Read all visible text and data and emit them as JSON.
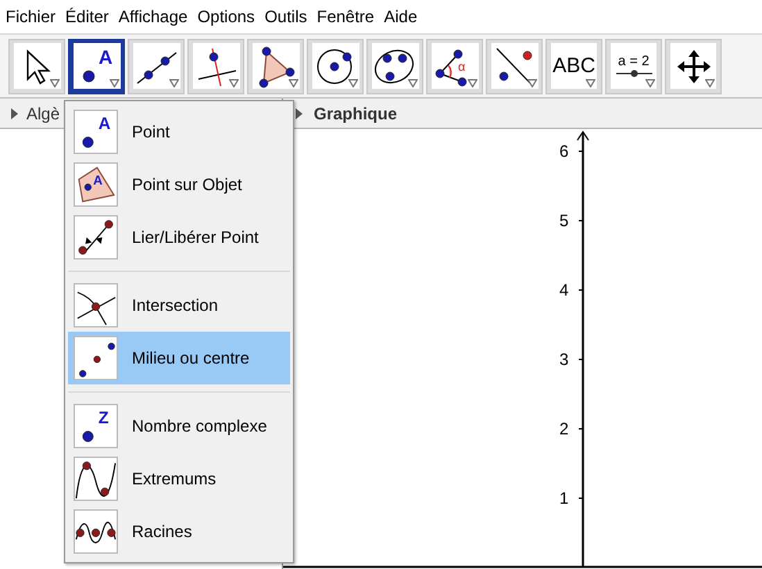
{
  "menubar": [
    "Fichier",
    "Éditer",
    "Affichage",
    "Options",
    "Outils",
    "Fenêtre",
    "Aide"
  ],
  "toolbar": [
    {
      "kind": "move",
      "selected": false
    },
    {
      "kind": "point",
      "letter": "A",
      "selected": true
    },
    {
      "kind": "line",
      "selected": false
    },
    {
      "kind": "perpendicular",
      "selected": false
    },
    {
      "kind": "polygon",
      "selected": false
    },
    {
      "kind": "circle",
      "selected": false
    },
    {
      "kind": "conic",
      "selected": false
    },
    {
      "kind": "angle",
      "letter": "α",
      "selected": false
    },
    {
      "kind": "reflect",
      "selected": false
    },
    {
      "kind": "text",
      "label": "ABC",
      "selected": false
    },
    {
      "kind": "slider",
      "label": "a = 2",
      "selected": false
    },
    {
      "kind": "move-view",
      "selected": false
    }
  ],
  "panels": [
    {
      "title": "Algè"
    },
    {
      "title": "Graphique"
    }
  ],
  "dropdown": {
    "groups": [
      [
        {
          "label": "Point",
          "kind": "point",
          "letter": "A",
          "selected": false
        },
        {
          "label": "Point sur Objet",
          "kind": "point-on-object",
          "letter": "A",
          "selected": false
        },
        {
          "label": "Lier/Libérer Point",
          "kind": "attach",
          "selected": false
        }
      ],
      [
        {
          "label": "Intersection",
          "kind": "intersect",
          "selected": false
        },
        {
          "label": "Milieu ou centre",
          "kind": "midpoint",
          "selected": true
        }
      ],
      [
        {
          "label": "Nombre complexe",
          "kind": "complex",
          "letter": "Z",
          "selected": false
        },
        {
          "label": "Extremums",
          "kind": "extremum",
          "selected": false
        },
        {
          "label": "Racines",
          "kind": "roots",
          "selected": false
        }
      ]
    ]
  },
  "graph": {
    "y_ticks": [
      "6",
      "5",
      "4",
      "3",
      "2",
      "1"
    ]
  }
}
